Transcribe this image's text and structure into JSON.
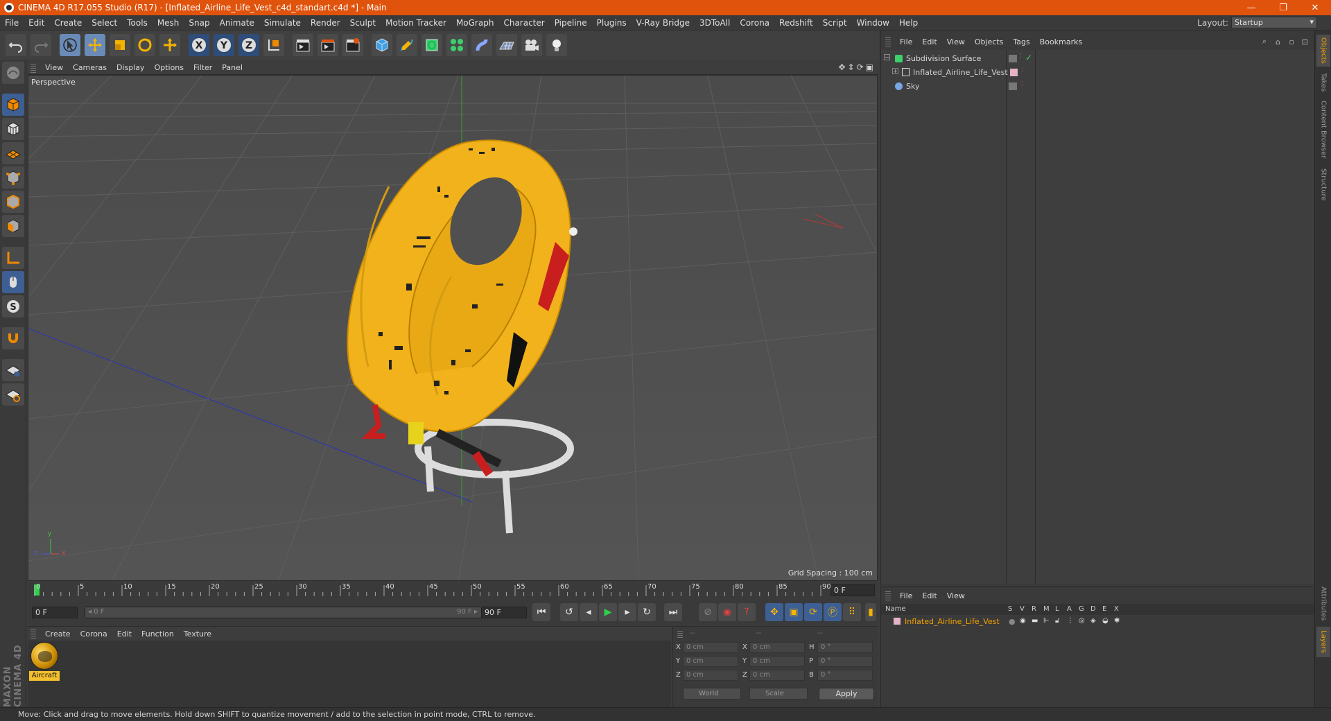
{
  "window": {
    "title": "CINEMA 4D R17.055 Studio (R17) - [Inflated_Airline_Life_Vest_c4d_standart.c4d *] - Main",
    "minimize": "—",
    "restore": "❐",
    "close": "✕"
  },
  "menubar": {
    "items": [
      "File",
      "Edit",
      "Create",
      "Select",
      "Tools",
      "Mesh",
      "Snap",
      "Animate",
      "Simulate",
      "Render",
      "Sculpt",
      "Motion Tracker",
      "MoGraph",
      "Character",
      "Pipeline",
      "Plugins",
      "V-Ray Bridge",
      "3DToAll",
      "Corona",
      "Redshift",
      "Script",
      "Window",
      "Help"
    ],
    "layout_label": "Layout:",
    "layout_value": "Startup"
  },
  "viewport": {
    "menu": [
      "View",
      "Cameras",
      "Display",
      "Options",
      "Filter",
      "Panel"
    ],
    "label": "Perspective",
    "grid_spacing": "Grid Spacing : 100 cm",
    "axis_y": "y",
    "axis_z": "z",
    "axis_x": "x"
  },
  "timeline": {
    "ticks": [
      "0",
      "5",
      "10",
      "15",
      "20",
      "25",
      "30",
      "35",
      "40",
      "45",
      "50",
      "55",
      "60",
      "65",
      "70",
      "75",
      "80",
      "85",
      "90"
    ],
    "current_frame": "0 F",
    "start_field": "0 F",
    "range_start": "◂ 0 F",
    "range_end": "90 F ▸",
    "end_field": "90 F"
  },
  "materials": {
    "menu": [
      "Create",
      "Corona",
      "Edit",
      "Function",
      "Texture"
    ],
    "items": [
      {
        "name": "Aircraft"
      }
    ]
  },
  "coordinates": {
    "headers": [
      "--",
      "--",
      "--"
    ],
    "rows": [
      {
        "l1": "X",
        "v1": "0 cm",
        "l2": "X",
        "v2": "0 cm",
        "l3": "H",
        "v3": "0 °"
      },
      {
        "l1": "Y",
        "v1": "0 cm",
        "l2": "Y",
        "v2": "0 cm",
        "l3": "P",
        "v3": "0 °"
      },
      {
        "l1": "Z",
        "v1": "0 cm",
        "l2": "Z",
        "v2": "0 cm",
        "l3": "B",
        "v3": "0 °"
      }
    ],
    "mode_world": "World",
    "mode_scale": "Scale",
    "apply": "Apply"
  },
  "object_manager": {
    "menu": [
      "File",
      "Edit",
      "View",
      "Objects",
      "Tags",
      "Bookmarks"
    ],
    "objects": [
      {
        "name": "Subdivision Surface"
      },
      {
        "name": "Inflated_Airline_Life_Vest"
      },
      {
        "name": "Sky"
      }
    ]
  },
  "layer_manager": {
    "menu": [
      "File",
      "Edit",
      "View"
    ],
    "columns": [
      "Name",
      "S",
      "V",
      "R",
      "M",
      "L",
      "A",
      "G",
      "D",
      "E",
      "X"
    ],
    "layers": [
      {
        "name": "Inflated_Airline_Life_Vest"
      }
    ]
  },
  "side_tabs": [
    "Objects",
    "Takes",
    "Content Browser",
    "Structure",
    "Attributes",
    "Layers"
  ],
  "statusbar": {
    "text": "Move: Click and drag to move elements. Hold down SHIFT to quantize movement / add to the selection in point mode, CTRL to remove."
  },
  "branding": {
    "maxon": "MAXON CINEMA 4D"
  },
  "colors": {
    "titlebar": "#e0530c",
    "vest_yellow": "#f2b21c",
    "accent_orange": "#f0a000",
    "active_tool": "#6a8bb7"
  }
}
